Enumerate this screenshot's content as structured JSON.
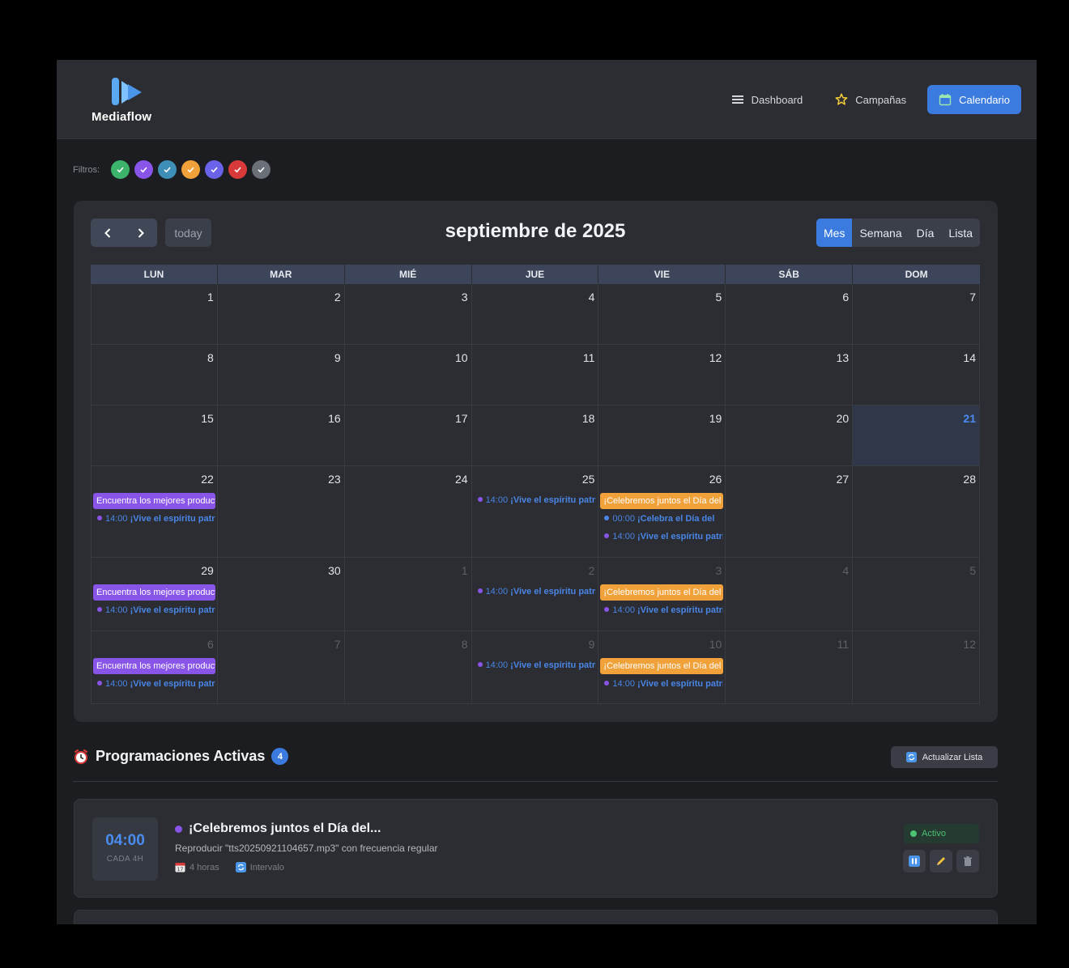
{
  "brand": {
    "name": "Mediaflow"
  },
  "nav": [
    {
      "label": "Dashboard",
      "icon": "menu-icon",
      "active": false
    },
    {
      "label": "Campañas",
      "icon": "star-icon",
      "active": false
    },
    {
      "label": "Calendario",
      "icon": "calendar-icon",
      "active": true
    }
  ],
  "filters": {
    "label": "Filtros:",
    "chips": [
      {
        "color": "#3bb36b",
        "checked": true
      },
      {
        "color": "#8855e8",
        "checked": true
      },
      {
        "color": "#3d8fb8",
        "checked": true
      },
      {
        "color": "#f0a13a",
        "checked": true
      },
      {
        "color": "#6a62e8",
        "checked": true
      },
      {
        "color": "#d83a3a",
        "checked": true
      },
      {
        "color": "#6b6f77",
        "checked": true
      }
    ]
  },
  "calendar": {
    "title": "septiembre de 2025",
    "today_label": "today",
    "views": [
      "Mes",
      "Semana",
      "Día",
      "Lista"
    ],
    "active_view": "Mes",
    "weekdays": [
      "LUN",
      "MAR",
      "MIÉ",
      "JUE",
      "VIE",
      "SÁB",
      "DOM"
    ],
    "weeks": [
      [
        {
          "d": "1"
        },
        {
          "d": "2"
        },
        {
          "d": "3"
        },
        {
          "d": "4"
        },
        {
          "d": "5"
        },
        {
          "d": "6"
        },
        {
          "d": "7"
        }
      ],
      [
        {
          "d": "8"
        },
        {
          "d": "9"
        },
        {
          "d": "10"
        },
        {
          "d": "11"
        },
        {
          "d": "12"
        },
        {
          "d": "13"
        },
        {
          "d": "14"
        }
      ],
      [
        {
          "d": "15"
        },
        {
          "d": "16"
        },
        {
          "d": "17"
        },
        {
          "d": "18"
        },
        {
          "d": "19"
        },
        {
          "d": "20"
        },
        {
          "d": "21",
          "today": true
        }
      ],
      [
        {
          "d": "22",
          "events": [
            {
              "kind": "block",
              "color": "#8855e8",
              "title": "Encuentra los mejores productos"
            },
            {
              "kind": "dot",
              "color": "#8855e8",
              "time": "14:00",
              "title": "¡Vive el espíritu patrio"
            }
          ]
        },
        {
          "d": "23"
        },
        {
          "d": "24"
        },
        {
          "d": "25",
          "events": [
            {
              "kind": "dot",
              "color": "#8855e8",
              "time": "14:00",
              "title": "¡Vive el espíritu patrio"
            }
          ]
        },
        {
          "d": "26",
          "events": [
            {
              "kind": "block",
              "color": "#f0a13a",
              "title": "¡Celebremos juntos el Día del"
            },
            {
              "kind": "dot",
              "color": "#4a85e6",
              "time": "00:00",
              "title": "¡Celebra el Día del"
            },
            {
              "kind": "dot",
              "color": "#8855e8",
              "time": "14:00",
              "title": "¡Vive el espíritu patrio"
            }
          ]
        },
        {
          "d": "27"
        },
        {
          "d": "28"
        }
      ],
      [
        {
          "d": "29",
          "events": [
            {
              "kind": "block",
              "color": "#8855e8",
              "title": "Encuentra los mejores productos"
            },
            {
              "kind": "dot",
              "color": "#8855e8",
              "time": "14:00",
              "title": "¡Vive el espíritu patrio"
            }
          ]
        },
        {
          "d": "30"
        },
        {
          "d": "1",
          "other": true
        },
        {
          "d": "2",
          "other": true,
          "events": [
            {
              "kind": "dot",
              "color": "#8855e8",
              "time": "14:00",
              "title": "¡Vive el espíritu patrio"
            }
          ]
        },
        {
          "d": "3",
          "other": true,
          "events": [
            {
              "kind": "block",
              "color": "#f0a13a",
              "title": "¡Celebremos juntos el Día del"
            },
            {
              "kind": "dot",
              "color": "#8855e8",
              "time": "14:00",
              "title": "¡Vive el espíritu patrio"
            }
          ]
        },
        {
          "d": "4",
          "other": true
        },
        {
          "d": "5",
          "other": true
        }
      ],
      [
        {
          "d": "6",
          "other": true,
          "events": [
            {
              "kind": "block",
              "color": "#8855e8",
              "title": "Encuentra los mejores productos"
            },
            {
              "kind": "dot",
              "color": "#8855e8",
              "time": "14:00",
              "title": "¡Vive el espíritu patrio"
            }
          ]
        },
        {
          "d": "7",
          "other": true
        },
        {
          "d": "8",
          "other": true
        },
        {
          "d": "9",
          "other": true,
          "events": [
            {
              "kind": "dot",
              "color": "#8855e8",
              "time": "14:00",
              "title": "¡Vive el espíritu patrio"
            }
          ]
        },
        {
          "d": "10",
          "other": true,
          "events": [
            {
              "kind": "block",
              "color": "#f0a13a",
              "title": "¡Celebremos juntos el Día del"
            },
            {
              "kind": "dot",
              "color": "#8855e8",
              "time": "14:00",
              "title": "¡Vive el espíritu patrio"
            }
          ]
        },
        {
          "d": "11",
          "other": true
        },
        {
          "d": "12",
          "other": true
        }
      ]
    ]
  },
  "schedules": {
    "title": "Programaciones Activas",
    "count": "4",
    "refresh_label": "Actualizar Lista",
    "items": [
      {
        "time": "04:00",
        "frequency": "CADA 4H",
        "title": "¡Celebremos juntos el Día del...",
        "description": "Reproducir \"tts20250921104657.mp3\" con frecuencia regular",
        "meta_interval": "4 horas",
        "meta_type": "Intervalo",
        "status": "Activo"
      }
    ]
  }
}
